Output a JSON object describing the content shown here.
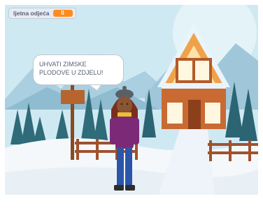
{
  "variable_monitor": {
    "name": "ljetna odjeća",
    "value": "0"
  },
  "speech_bubble": {
    "text": "UHVATI ZIMSKE\nPLODOVE U ZDJELU!"
  },
  "colors": {
    "sky": "#cfe9f2",
    "snow": "#f4f8fb",
    "monitor_accent": "#ff8c1a",
    "cabin_wood": "#c96a33",
    "roof_snow": "#eaf4fb"
  }
}
